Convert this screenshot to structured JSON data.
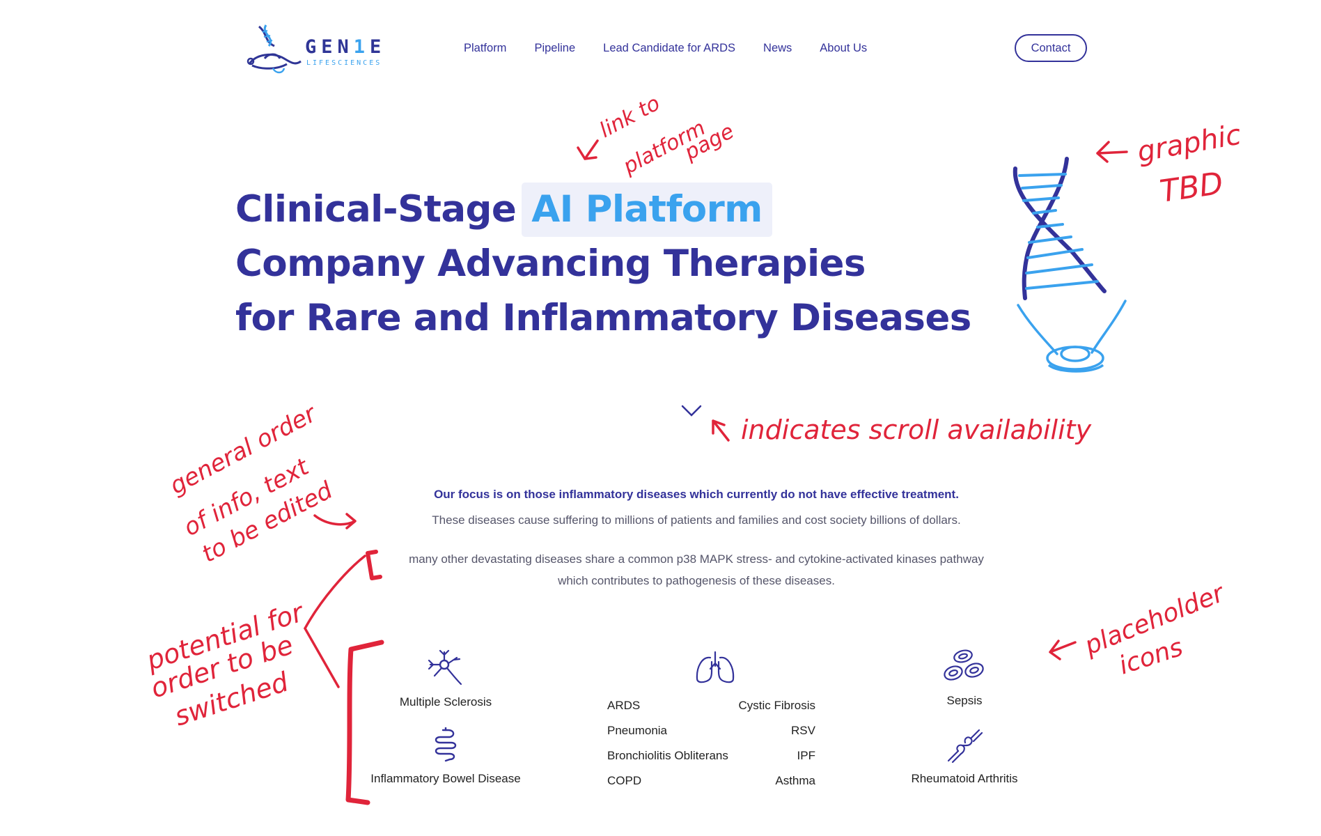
{
  "brand": {
    "name": "GEN1E",
    "name_part1": "GEN",
    "name_part2": "1",
    "name_part3": "E",
    "tagline": "LIFESCIENCES"
  },
  "nav": {
    "items": [
      {
        "label": "Platform"
      },
      {
        "label": "Pipeline"
      },
      {
        "label": "Lead Candidate for ARDS"
      },
      {
        "label": "News"
      },
      {
        "label": "About Us"
      }
    ],
    "contact_label": "Contact"
  },
  "hero": {
    "line1_prefix": "Clinical-Stage",
    "line1_highlight": "AI Platform",
    "line2": "Company Advancing Therapies",
    "line3": "for Rare and Inflammatory Diseases"
  },
  "intro": {
    "focus": "Our focus is on those inflammatory diseases which currently do not have effective treatment.",
    "cost": "These diseases cause suffering to millions of patients and families and cost society billions of dollars.",
    "pathway_line1": "many other devastating diseases share a common p38 MAPK stress- and cytokine-activated kinases pathway",
    "pathway_line2": "which contributes to pathogenesis of these diseases."
  },
  "diseases": {
    "multiple_sclerosis": "Multiple Sclerosis",
    "ibd": "Inflammatory Bowel Disease",
    "respiratory_left": [
      "ARDS",
      "Pneumonia",
      "Bronchiolitis Obliterans",
      "COPD"
    ],
    "respiratory_right": [
      "Cystic Fibrosis",
      "RSV",
      "IPF",
      "Asthma"
    ],
    "sepsis": "Sepsis",
    "ra": "Rheumatoid Arthritis"
  },
  "annotations": {
    "link_note_1": "link to",
    "link_note_2": "platform",
    "link_note_3": "page",
    "graphic_note_1": "graphic",
    "graphic_note_2": "TBD",
    "scroll_note": "indicates scroll availability",
    "order_note_1": "general order",
    "order_note_2": "of info, text",
    "order_note_3": "to be edited",
    "switch_note_1": "potential for",
    "switch_note_2": "order to be",
    "switch_note_3": "switched",
    "icons_note_1": "placeholder",
    "icons_note_2": "icons"
  },
  "colors": {
    "primary": "#33329a",
    "accent": "#3aa2ee",
    "annotation": "#e0243a"
  },
  "icons": [
    "dna-logo-icon",
    "dna-graphic-icon",
    "chevron-down-icon",
    "neuron-icon",
    "intestine-icon",
    "lungs-icon",
    "blood-cells-icon",
    "joint-icon"
  ]
}
